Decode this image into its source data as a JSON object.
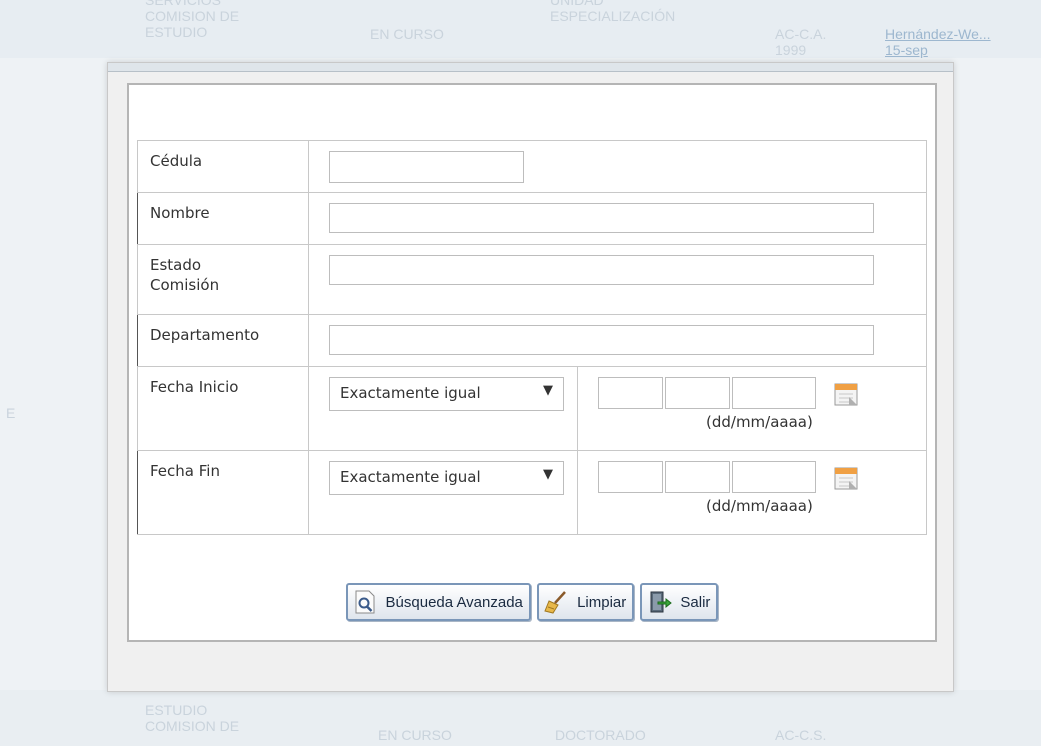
{
  "background": {
    "top_row": {
      "col1": "SERVICIOS\nCOMISION DE\nESTUDIO",
      "col2": "EN CURSO",
      "col3": "UNIDAD\nESPECIALIZACIÓN",
      "col4": "AC-C.A.\n1999",
      "col5": "Hernández-We...\n15-sep"
    },
    "bottom_row": {
      "col1": "ESTUDIO\nCOMISION DE",
      "col2": "EN CURSO",
      "col3": "DOCTORADO",
      "col4": "AC-C.S."
    },
    "left_marker": "E"
  },
  "form": {
    "fields": {
      "cedula": {
        "label": "Cédula",
        "value": ""
      },
      "nombre": {
        "label": "Nombre",
        "value": ""
      },
      "estado_comision": {
        "label": "Estado\nComisión",
        "value": ""
      },
      "departamento": {
        "label": "Departamento",
        "value": ""
      }
    },
    "fecha_inicio": {
      "label": "Fecha Inicio",
      "operator": "Exactamente igual",
      "day": "",
      "month": "",
      "year": "",
      "format_hint": "(dd/mm/aaaa)"
    },
    "fecha_fin": {
      "label": "Fecha Fin",
      "operator": "Exactamente igual",
      "day": "",
      "month": "",
      "year": "",
      "format_hint": "(dd/mm/aaaa)"
    }
  },
  "buttons": {
    "search": "Búsqueda Avanzada",
    "clear": "Limpiar",
    "exit": "Salir"
  },
  "icons": {
    "search_button": "magnifier-icon",
    "clear_button": "broom-icon",
    "exit_button": "exit-door-icon",
    "calendar": "calendar-icon",
    "dropdown": "triangle-down-icon"
  },
  "colors": {
    "button_border": "#7a96b8",
    "panel_border": "#b5b5b5",
    "background": "#eef2f5"
  }
}
